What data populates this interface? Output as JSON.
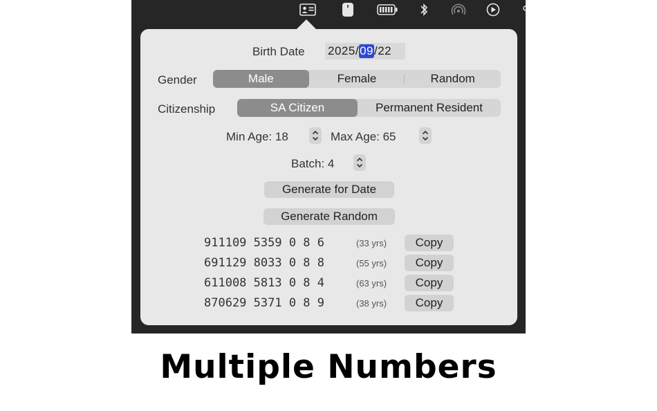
{
  "form": {
    "birth_date_label": "Birth Date",
    "birth_date": {
      "year": "2025",
      "sep1": "/",
      "month": "09",
      "sep2": "/",
      "day": "22"
    },
    "gender_label": "Gender",
    "gender_options": [
      "Male",
      "Female",
      "Random"
    ],
    "gender_selected": "Male",
    "citizenship_label": "Citizenship",
    "citizenship_options": [
      "SA Citizen",
      "Permanent Resident"
    ],
    "citizenship_selected": "SA Citizen",
    "min_age_label": "Min Age: 18",
    "max_age_label": "Max Age: 65",
    "batch_label": "Batch: 4",
    "generate_for_date": "Generate for Date",
    "generate_random": "Generate Random"
  },
  "results": [
    {
      "number": "911109 5359 0 8 6",
      "age": "(33 yrs)",
      "copy": "Copy"
    },
    {
      "number": "691129 8033 0 8 8",
      "age": "(55 yrs)",
      "copy": "Copy"
    },
    {
      "number": "611008 5813 0 8 4",
      "age": "(63 yrs)",
      "copy": "Copy"
    },
    {
      "number": "870629 5371 0 8 9",
      "age": "(38 yrs)",
      "copy": "Copy"
    }
  ],
  "menubar_icons": [
    "contact-card-icon",
    "mouse-icon",
    "battery-icon",
    "bluetooth-icon",
    "airdrop-icon",
    "play-circle-icon"
  ],
  "caption": "Multiple Numbers",
  "colors": {
    "selection_blue": "#2e49d0",
    "segment_selected": "#8c8c8c",
    "popover_bg": "#e8e8e8",
    "menubar_bg": "#262626"
  }
}
